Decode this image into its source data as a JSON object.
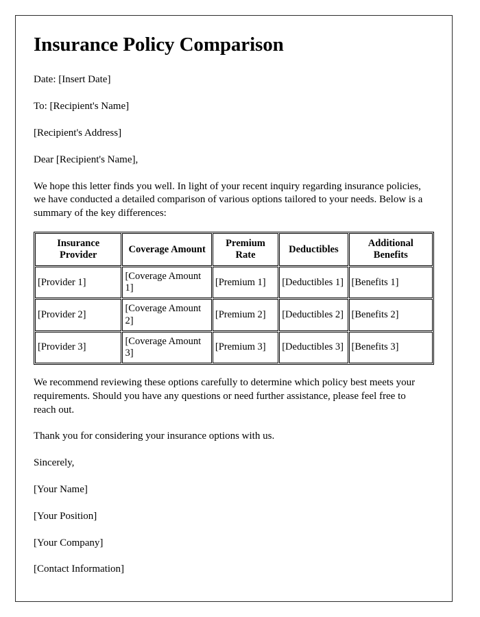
{
  "document": {
    "title": "Insurance Policy Comparison",
    "date_line": "Date: [Insert Date]",
    "to_line": "To: [Recipient's Name]",
    "address_line": "[Recipient's Address]",
    "salutation": "Dear [Recipient's Name],",
    "intro_paragraph": "We hope this letter finds you well. In light of your recent inquiry regarding insurance policies, we have conducted a detailed comparison of various options tailored to your needs. Below is a summary of the key differences:",
    "recommendation_paragraph": "We recommend reviewing these options carefully to determine which policy best meets your requirements. Should you have any questions or need further assistance, please feel free to reach out.",
    "thanks_paragraph": "Thank you for considering your insurance options with us.",
    "closing": "Sincerely,",
    "signature_lines": [
      "[Your Name]",
      "[Your Position]",
      "[Your Company]",
      "[Contact Information]"
    ]
  },
  "comparison_table": {
    "headers": [
      "Insurance Provider",
      "Coverage Amount",
      "Premium Rate",
      "Deductibles",
      "Additional Benefits"
    ],
    "rows": [
      {
        "provider": "[Provider 1]",
        "coverage": "[Coverage Amount 1]",
        "premium": "[Premium 1]",
        "deductibles": "[Deductibles 1]",
        "benefits": "[Benefits 1]"
      },
      {
        "provider": "[Provider 2]",
        "coverage": "[Coverage Amount 2]",
        "premium": "[Premium 2]",
        "deductibles": "[Deductibles 2]",
        "benefits": "[Benefits 2]"
      },
      {
        "provider": "[Provider 3]",
        "coverage": "[Coverage Amount 3]",
        "premium": "[Premium 3]",
        "deductibles": "[Deductibles 3]",
        "benefits": "[Benefits 3]"
      }
    ]
  },
  "colors": {
    "page_border": "#2b2b2b",
    "text": "#000000",
    "table_border": "#000000",
    "background": "#ffffff"
  }
}
